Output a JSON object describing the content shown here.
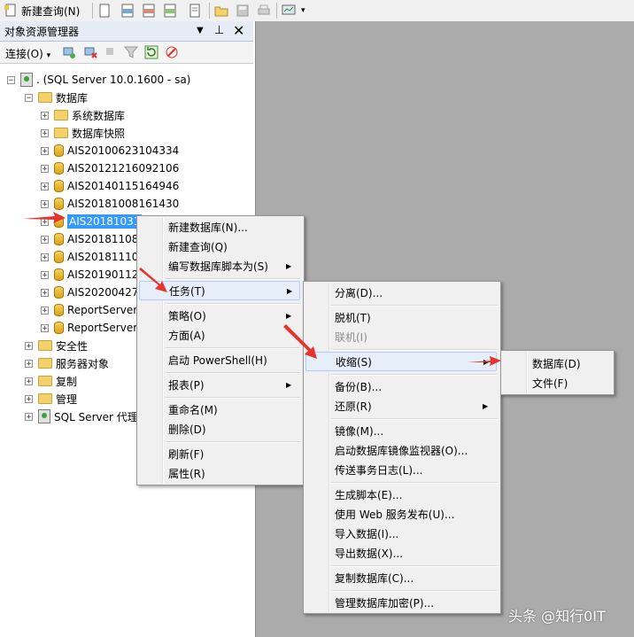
{
  "toolbar": {
    "new_query_label": "新建查询(N)"
  },
  "explorer": {
    "title": "对象资源管理器",
    "pin_glyph": "▾ 📌 ✕",
    "connect_label": "连接(O)"
  },
  "tree": {
    "server": ". (SQL Server 10.0.1600 - sa)",
    "databases_folder": "数据库",
    "system_db": "系统数据库",
    "snapshots": "数据库快照",
    "dbs": [
      "AIS20100623104334",
      "AIS20121216092106",
      "AIS20140115164946",
      "AIS20181008161430",
      "AIS20181031",
      "AIS20181108",
      "AIS20181110",
      "AIS20190112",
      "AIS20200427",
      "ReportServer",
      "ReportServer"
    ],
    "security": "安全性",
    "server_objects": "服务器对象",
    "replication": "复制",
    "management": "管理",
    "agent": "SQL Server 代理"
  },
  "menu1": {
    "items": [
      "新建数据库(N)...",
      "新建查询(Q)",
      "编写数据库脚本为(S)",
      "任务(T)",
      "策略(O)",
      "方面(A)",
      "启动 PowerShell(H)",
      "报表(P)",
      "重命名(M)",
      "删除(D)",
      "刷新(F)",
      "属性(R)"
    ]
  },
  "menu2": {
    "items": [
      "分离(D)...",
      "脱机(T)",
      "联机(I)",
      "收缩(S)",
      "备份(B)...",
      "还原(R)",
      "镜像(M)...",
      "启动数据库镜像监视器(O)...",
      "传送事务日志(L)...",
      "生成脚本(E)...",
      "使用 Web 服务发布(U)...",
      "导入数据(I)...",
      "导出数据(X)...",
      "复制数据库(C)...",
      "管理数据库加密(P)..."
    ]
  },
  "menu3": {
    "items": [
      "数据库(D)",
      "文件(F)"
    ]
  },
  "watermark": "头条 @知行0IT",
  "colors": {
    "selection": "#3399ff",
    "arrow": "#e8322e",
    "highlight": "#e6eefa"
  }
}
